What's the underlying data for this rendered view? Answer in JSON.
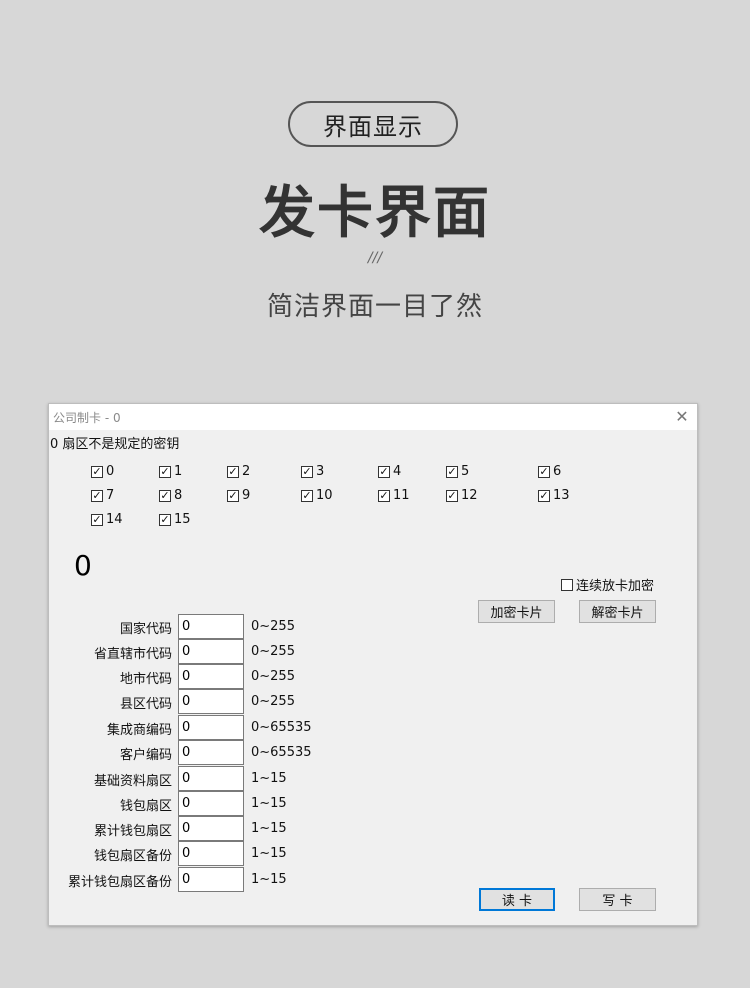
{
  "promo": {
    "pill_label": "界面显示",
    "headline": "发卡界面",
    "slashes": "///",
    "subline": "简洁界面一目了然"
  },
  "window": {
    "title": "公司制卡 - 0",
    "close_symbol": "✕",
    "status_text": "0  扇区不是规定的密钥",
    "sectors": [
      {
        "label": "0",
        "checked": true
      },
      {
        "label": "1",
        "checked": true
      },
      {
        "label": "2",
        "checked": true
      },
      {
        "label": "3",
        "checked": true
      },
      {
        "label": "4",
        "checked": true
      },
      {
        "label": "5",
        "checked": true
      },
      {
        "label": "6",
        "checked": true
      },
      {
        "label": "7",
        "checked": true
      },
      {
        "label": "8",
        "checked": true
      },
      {
        "label": "9",
        "checked": true
      },
      {
        "label": "10",
        "checked": true
      },
      {
        "label": "11",
        "checked": true
      },
      {
        "label": "12",
        "checked": true
      },
      {
        "label": "13",
        "checked": true
      },
      {
        "label": "14",
        "checked": true
      },
      {
        "label": "15",
        "checked": true
      }
    ],
    "big_number": "0",
    "continuous_encrypt": {
      "label": "连续放卡加密",
      "checked": false
    },
    "encrypt_button": "加密卡片",
    "decrypt_button": "解密卡片",
    "fields": [
      {
        "label": "国家代码",
        "value": "0",
        "range": "0~255"
      },
      {
        "label": "省直辖市代码",
        "value": "0",
        "range": "0~255"
      },
      {
        "label": "地市代码",
        "value": "0",
        "range": "0~255"
      },
      {
        "label": "县区代码",
        "value": "0",
        "range": "0~255"
      },
      {
        "label": "集成商编码",
        "value": "0",
        "range": "0~65535"
      },
      {
        "label": "客户编码",
        "value": "0",
        "range": "0~65535"
      },
      {
        "label": "基础资料扇区",
        "value": "0",
        "range": "1~15"
      },
      {
        "label": "钱包扇区",
        "value": "0",
        "range": "1~15"
      },
      {
        "label": "累计钱包扇区",
        "value": "0",
        "range": "1~15"
      },
      {
        "label": "钱包扇区备份",
        "value": "0",
        "range": "1~15"
      },
      {
        "label": "累计钱包扇区备份",
        "value": "0",
        "range": "1~15"
      }
    ],
    "read_button": "读    卡",
    "write_button": "写    卡"
  },
  "colors": {
    "background": "#d7d7d7",
    "accent": "#0078d7"
  }
}
